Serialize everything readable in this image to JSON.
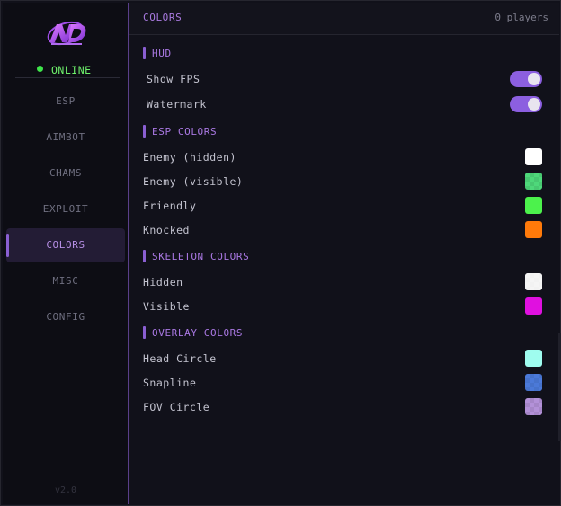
{
  "sidebar": {
    "status": "ONLINE",
    "items": [
      {
        "label": "ESP"
      },
      {
        "label": "AIMBOT"
      },
      {
        "label": "CHAMS"
      },
      {
        "label": "EXPLOIT"
      },
      {
        "label": "COLORS",
        "active": true
      },
      {
        "label": "MISC"
      },
      {
        "label": "CONFIG"
      }
    ],
    "version": "v2.0"
  },
  "header": {
    "title": "COLORS",
    "players": "0 players"
  },
  "sections": {
    "hud": {
      "title": "HUD",
      "toggles": [
        {
          "label": "Show FPS",
          "on": true
        },
        {
          "label": "Watermark",
          "on": true
        }
      ]
    },
    "esp_colors": {
      "title": "ESP COLORS",
      "items": [
        {
          "label": "Enemy (hidden)",
          "color": "#ffffff",
          "alpha": 1.0
        },
        {
          "label": "Enemy (visible)",
          "color": "#4fd87a",
          "alpha": 0.7
        },
        {
          "label": "Friendly",
          "color": "#4cf24c",
          "alpha": 1.0
        },
        {
          "label": "Knocked",
          "color": "#ff7a0a",
          "alpha": 1.0
        }
      ]
    },
    "skeleton_colors": {
      "title": "SKELETON COLORS",
      "items": [
        {
          "label": "Hidden",
          "color": "#f4f4f4",
          "alpha": 0.95
        },
        {
          "label": "Visible",
          "color": "#e010e0",
          "alpha": 1.0
        }
      ]
    },
    "overlay_colors": {
      "title": "OVERLAY COLORS",
      "items": [
        {
          "label": "Head Circle",
          "color": "#9ffcef",
          "alpha": 1.0
        },
        {
          "label": "Snapline",
          "color": "#4b7ad8",
          "alpha": 0.75
        },
        {
          "label": "FOV Circle",
          "color": "#b392d8",
          "alpha": 0.7
        }
      ]
    }
  },
  "colors": {
    "accent": "#8c5fe0",
    "online": "#3ee54a",
    "background": "#11111a"
  }
}
